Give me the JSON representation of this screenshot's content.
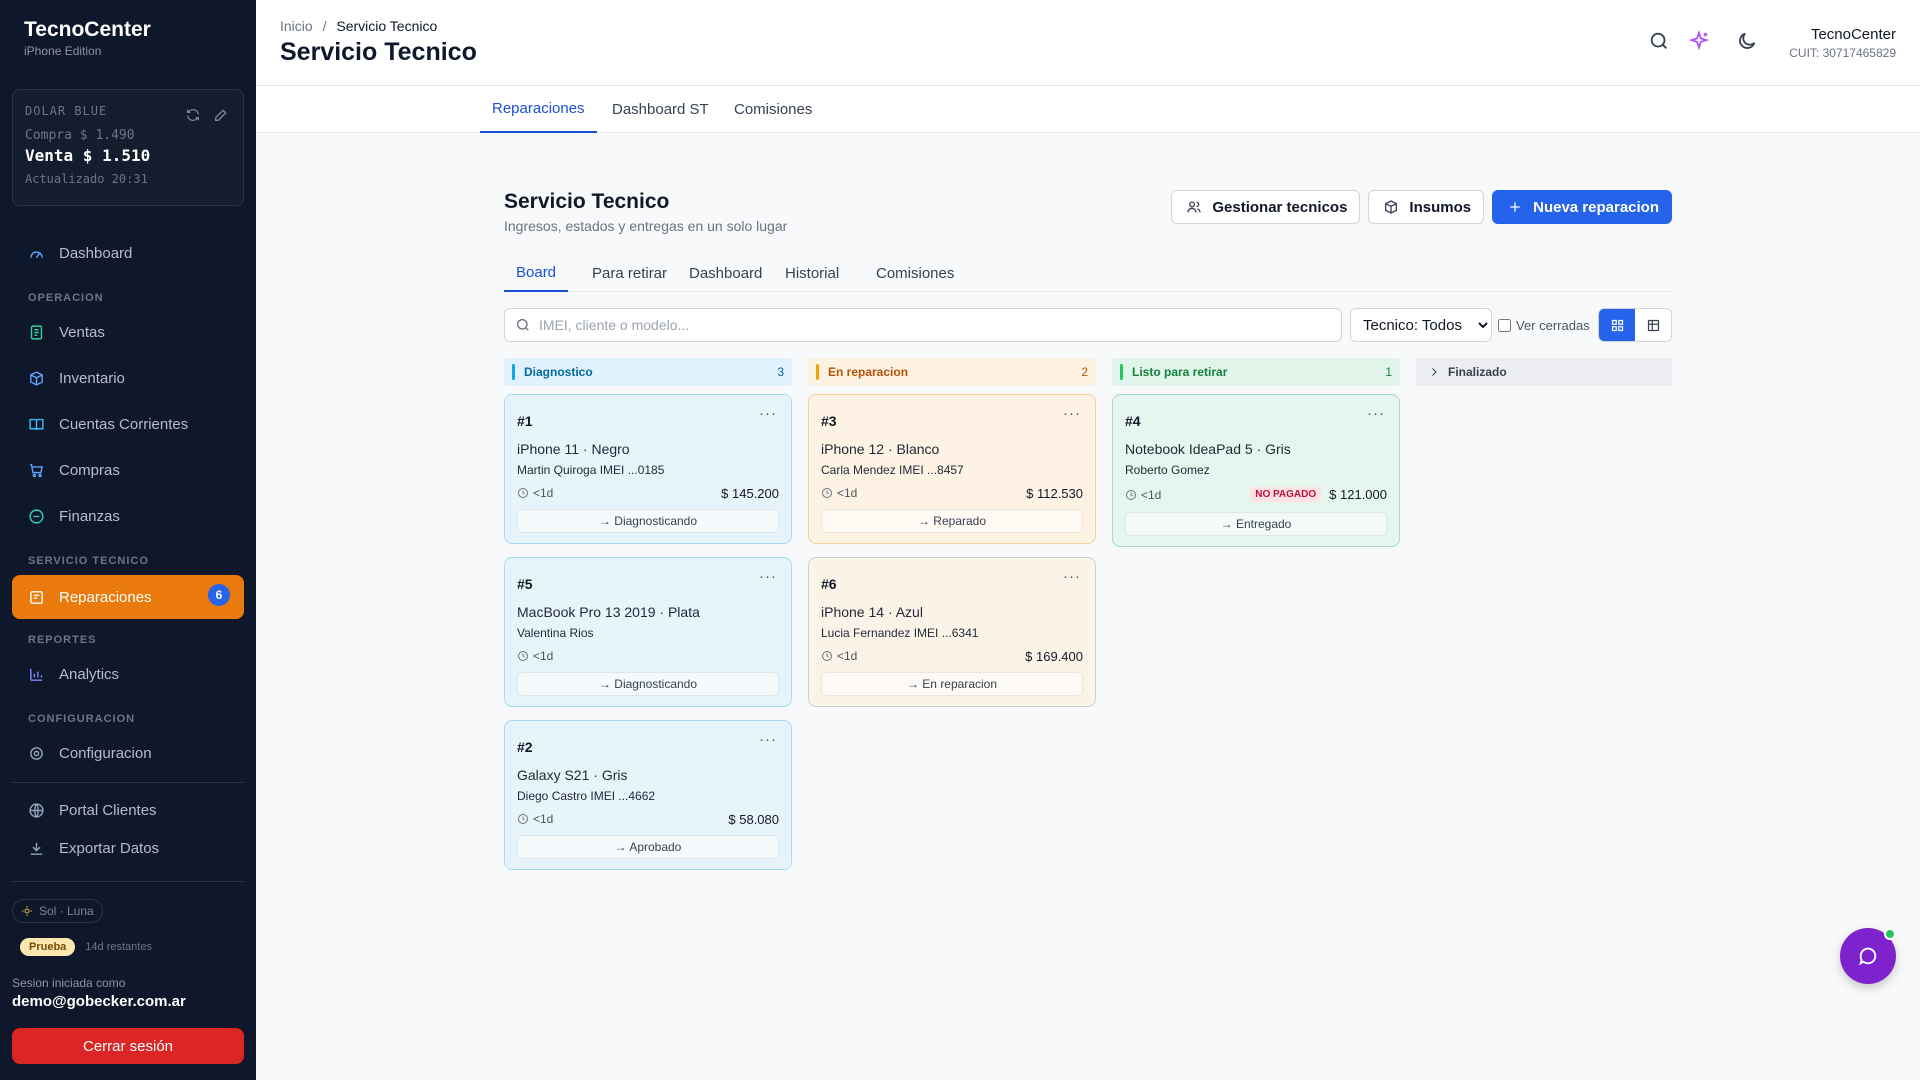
{
  "brand": {
    "title": "TecnoCenter",
    "subtitle": "iPhone Edition"
  },
  "dolar": {
    "label": "DOLAR BLUE",
    "compra": "Compra $ 1.490",
    "venta": "Venta $ 1.510",
    "updated": "Actualizado 20:31"
  },
  "sidebar": {
    "dashboard": "Dashboard",
    "sections": {
      "operacion": "OPERACION",
      "servicio": "SERVICIO TECNICO",
      "reportes": "REPORTES",
      "config": "CONFIGURACION"
    },
    "items": {
      "ventas": "Ventas",
      "inventario": "Inventario",
      "cuentas": "Cuentas Corrientes",
      "compras": "Compras",
      "finanzas": "Finanzas",
      "reparaciones": "Reparaciones",
      "reparaciones_badge": "6",
      "analytics": "Analytics",
      "configuracion": "Configuracion",
      "portal": "Portal Clientes",
      "exportar": "Exportar Datos"
    },
    "theme": "Sol · Luna",
    "trial_badge": "Prueba",
    "trial_days": "14d restantes",
    "session_label": "Sesion iniciada como",
    "session_email": "demo@gobecker.com.ar",
    "logout": "Cerrar sesión"
  },
  "header": {
    "crumb_home": "Inicio",
    "crumb_sep": "/",
    "crumb_current": "Servicio Tecnico",
    "title": "Servicio Tecnico",
    "user_name": "TecnoCenter",
    "user_cuit": "CUIT: 30717465829"
  },
  "main_tabs": [
    "Reparaciones",
    "Dashboard ST",
    "Comisiones"
  ],
  "section": {
    "title": "Servicio Tecnico",
    "subtitle": "Ingresos, estados y entregas en un solo lugar",
    "btn_tecnicos": "Gestionar tecnicos",
    "btn_insumos": "Insumos",
    "btn_nueva": "Nueva reparacion"
  },
  "sub_tabs": [
    "Board",
    "Para retirar",
    "Dashboard",
    "Historial",
    "Comisiones"
  ],
  "filters": {
    "search_placeholder": "IMEI, cliente o modelo...",
    "tecnico_selected": "Tecnico: Todos",
    "ver_cerradas": "Ver cerradas"
  },
  "columns": [
    {
      "name": "Diagnostico",
      "count": "3",
      "color": "#0ea5e9"
    },
    {
      "name": "En reparacion",
      "count": "2",
      "color": "#f59e0b"
    },
    {
      "name": "Listo para retirar",
      "count": "1",
      "color": "#22c55e"
    },
    {
      "name": "Finalizado",
      "count": ""
    }
  ],
  "cards": {
    "c1": {
      "id": "#1",
      "model": "iPhone 11 · Negro",
      "client": "Martin Quiroga  IMEI ...0185",
      "time": "<1d",
      "amount": "$ 145.200",
      "state": "→ Diagnosticando"
    },
    "c5": {
      "id": "#5",
      "model": "MacBook Pro 13 2019 · Plata",
      "client": "Valentina Rios",
      "time": "<1d",
      "amount": "",
      "state": "→ Diagnosticando"
    },
    "c2": {
      "id": "#2",
      "model": "Galaxy S21 · Gris",
      "client": "Diego Castro  IMEI ...4662",
      "time": "<1d",
      "amount": "$ 58.080",
      "state": "→ Aprobado"
    },
    "c3": {
      "id": "#3",
      "model": "iPhone 12 · Blanco",
      "client": "Carla Mendez  IMEI ...8457",
      "time": "<1d",
      "amount": "$ 112.530",
      "state": "→ Reparado"
    },
    "c6": {
      "id": "#6",
      "model": "iPhone 14 · Azul",
      "client": "Lucia Fernandez  IMEI ...6341",
      "time": "<1d",
      "amount": "$ 169.400",
      "state": "→ En reparacion"
    },
    "c4": {
      "id": "#4",
      "model": "Notebook IdeaPad 5 · Gris",
      "client": "Roberto Gomez",
      "time": "<1d",
      "badge": "NO PAGADO",
      "amount": "$ 121.000",
      "state": "→ Entregado"
    }
  },
  "more_glyph": "···"
}
